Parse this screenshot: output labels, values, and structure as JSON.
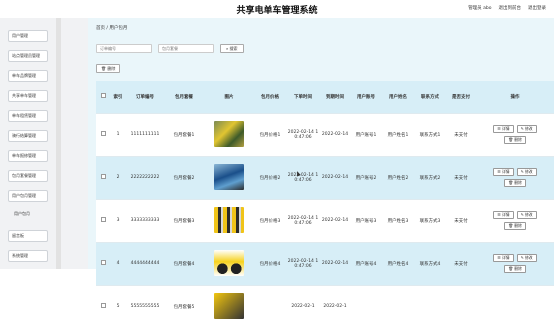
{
  "app": {
    "title": "共享电单车管理系统",
    "top_links": [
      "管理员 abo",
      "退出到前台",
      "退出登录"
    ]
  },
  "sidebar": {
    "items": [
      "用户管理",
      "站点管理员管理",
      "单车品牌管理",
      "共享单车管理",
      "单车租赁管理",
      "骑行结算管理",
      "单车报修管理",
      "包月套餐管理",
      "用户包月管理",
      "留言板",
      "系统管理"
    ],
    "sub_items": [
      "用户包月"
    ]
  },
  "breadcrumb": "首页 / 用户包月",
  "search": {
    "placeholder1": "订单编号",
    "placeholder2": "包月套餐",
    "button": "搜索"
  },
  "toolbar": {
    "delete": "删除"
  },
  "table": {
    "headers": [
      "",
      "索引",
      "订单编号",
      "包月套餐",
      "图片",
      "包月价格",
      "下单时间",
      "到期时间",
      "用户账号",
      "用户姓名",
      "联系方式",
      "是否支付",
      "操作"
    ],
    "rows": [
      {
        "index": "1",
        "order": "1111111111",
        "plan": "包月套餐1",
        "price": "包月价格1",
        "order_time": "2022-02-14 10:47:06",
        "expire": "2022-02-14",
        "account": "用户账号1",
        "name": "用户姓名1",
        "contact": "联系方式1",
        "paid": "未支付",
        "img": "bike-yellow-green"
      },
      {
        "index": "2",
        "order": "2222222222",
        "plan": "包月套餐2",
        "price": "包月价格2",
        "order_time": "2022-02-14 10:47:06",
        "expire": "2022-02-14",
        "account": "用户账号2",
        "name": "用户姓名2",
        "contact": "联系方式2",
        "paid": "未支付",
        "img": "bike-blue"
      },
      {
        "index": "3",
        "order": "3333333333",
        "plan": "包月套餐3",
        "price": "包月价格3",
        "order_time": "2022-02-14 10:47:06",
        "expire": "2022-02-14",
        "account": "用户账号3",
        "name": "用户姓名3",
        "contact": "联系方式3",
        "paid": "未支付",
        "img": "bike-row"
      },
      {
        "index": "4",
        "order": "4444444444",
        "plan": "包月套餐4",
        "price": "包月价格4",
        "order_time": "2022-02-14 10:47:06",
        "expire": "2022-02-14",
        "account": "用户账号4",
        "name": "用户姓名4",
        "contact": "联系方式4",
        "paid": "未支付",
        "img": "ebike-yellow"
      },
      {
        "index": "5",
        "order": "5555555555",
        "plan": "包月套餐5",
        "price": "",
        "order_time": "2022-02-1",
        "expire": "2022-02-1",
        "account": "",
        "name": "",
        "contact": "",
        "paid": "",
        "img": "bike-yellow"
      }
    ],
    "actions": {
      "detail": "详情",
      "edit": "修改",
      "delete": "删除"
    }
  },
  "colors": {
    "header_bg": "#d7eef7",
    "main_bg": "#eaf6fa"
  }
}
